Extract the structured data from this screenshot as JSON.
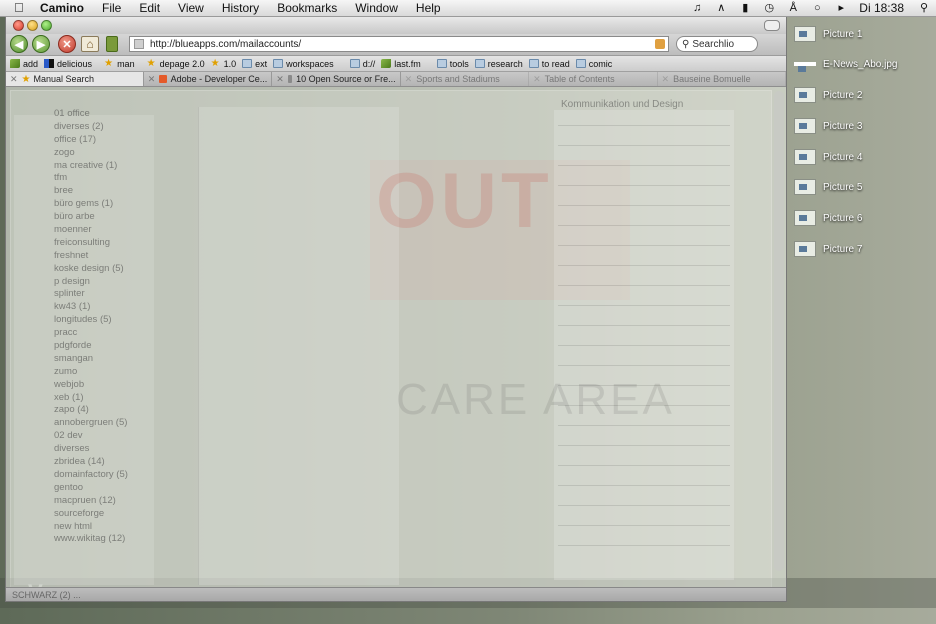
{
  "menubar": {
    "app_name": "Camino",
    "items": [
      "File",
      "Edit",
      "View",
      "History",
      "Bookmarks",
      "Window",
      "Help"
    ],
    "clock": "Di 18:38"
  },
  "desktop_icons": [
    {
      "label": "Picture 1",
      "type": "image"
    },
    {
      "label": "E-News_Abo.jpg",
      "type": "bar"
    },
    {
      "label": "Picture 2",
      "type": "image"
    },
    {
      "label": "Picture 3",
      "type": "image"
    },
    {
      "label": "Picture 4",
      "type": "image"
    },
    {
      "label": "Picture 5",
      "type": "image"
    },
    {
      "label": "Picture 6",
      "type": "image"
    },
    {
      "label": "Picture 7",
      "type": "image"
    }
  ],
  "navbar": {
    "url": "http://blueapps.com/mailaccounts/",
    "search_placeholder": "Searchlio"
  },
  "bookmarks": [
    {
      "label": "add",
      "icon": "leaf"
    },
    {
      "label": "delicious",
      "icon": "delicious"
    },
    {
      "label": "man",
      "icon": "star"
    },
    {
      "label": "depage 2.0",
      "icon": "star"
    },
    {
      "label": "1.0",
      "icon": "star"
    },
    {
      "label": "ext",
      "icon": "folder"
    },
    {
      "label": "workspaces",
      "icon": "folder"
    },
    {
      "label": "d://",
      "icon": "folder"
    },
    {
      "label": "last.fm",
      "icon": "leaf"
    },
    {
      "label": "tools",
      "icon": "folder"
    },
    {
      "label": "research",
      "icon": "folder"
    },
    {
      "label": "to read",
      "icon": "folder"
    },
    {
      "label": "comic",
      "icon": "folder"
    }
  ],
  "tabs": [
    {
      "label": "Manual Search",
      "active": true
    },
    {
      "label": "Adobe - Developer Ce...",
      "active": false
    },
    {
      "label": "10 Open Source or Fre...",
      "active": false
    },
    {
      "label": "Sports and Stadiums",
      "active": false
    },
    {
      "label": "Table of Contents",
      "active": false
    },
    {
      "label": "Bauseine Bomuelle",
      "active": false
    }
  ],
  "folders": [
    "01 office",
    "diverses (2)",
    "office (17)",
    "zogo",
    "ma creative (1)",
    "tfm",
    "bree",
    "büro gems (1)",
    "büro arbe",
    "moenner",
    "freiconsulting",
    "freshnet",
    "koske design (5)",
    "p design",
    "splinter",
    "kw43 (1)",
    "longitudes (5)",
    "pracc",
    "pdgforde",
    "smangan",
    "zumo",
    "webjob",
    "xeb (1)",
    "zapo (4)",
    "annobergruen (5)",
    "02 dev",
    "diverses",
    "zbridea (14)",
    "domainfactory (5)",
    "gentoo",
    "macpruen (12)",
    "sourceforge",
    "new html",
    "www.wikitag (12)"
  ],
  "ghost": {
    "heading": "Kommunikation und Design",
    "big_text": "OUT",
    "care_text": "CARE AREA",
    "status": "SCHWARZ (2) ..."
  }
}
